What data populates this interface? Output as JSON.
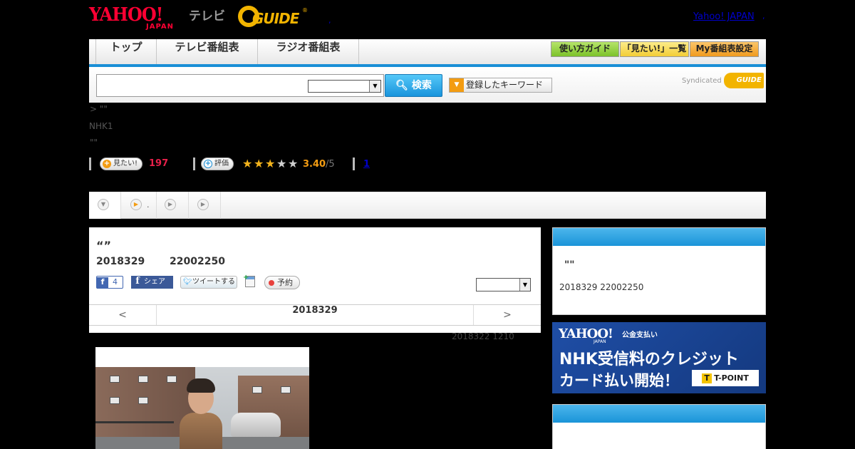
{
  "header": {
    "yahoo_logo": "YAHOO!",
    "yahoo_logo_sub": "JAPAN",
    "tv_label": "テレビ",
    "gguide_logo": "GUIDE",
    "gguide_mark": "®",
    "dot": ",",
    "yahoo_japan_link": "Yahoo! JAPAN",
    "dot2": ","
  },
  "nav": {
    "tabs": [
      "トップ",
      "テレビ番組表",
      "ラジオ番組表"
    ],
    "buttons": [
      "使い方ガイド",
      "「見たい!」一覧",
      "My番組表設定"
    ],
    "button_colors": [
      "#8fd13a",
      "#f8d94c",
      "#f5a623"
    ]
  },
  "search": {
    "input_value": "",
    "select_value": "",
    "button_label": "検索",
    "keyword_button_label": "登録したキーワード",
    "syndicated_label": "Syndicated",
    "syndicated_logo": "GUIDE"
  },
  "program": {
    "breadcrumb": "> \"\"",
    "channel": "NHK1",
    "subtitle": "\"\"",
    "mitai_label": "見たい!",
    "mitai_count": "197",
    "rate_label": "評価",
    "rating_stars": 3.4,
    "rating_value": "3.40",
    "rating_max": "/5",
    "review_count": "1",
    "title": "“”",
    "air_date": "2018329",
    "air_time": "22002250",
    "fb_like_count": "4",
    "fb_share_label": "シェア",
    "tweet_label": "ツイートする",
    "reserve_label": "予約",
    "select_value": "",
    "prev_label": "<",
    "nav_date": "2018329",
    "next_label": ">",
    "update_note": "2018322  1210"
  },
  "tabs_strip": {
    "tab2_text": "."
  },
  "sidebar": {
    "box1_title": "\"\"",
    "box1_date": "2018329  22002250"
  },
  "ad": {
    "yahoo": "YAHOO!",
    "japan": "JAPAN",
    "service": "公金支払い",
    "line1": "NHK受信料のクレジット",
    "line2": "カード払い開始！",
    "tpoint": "T-POINT",
    "tpoint_mark": "T"
  },
  "colors": {
    "accent_blue": "#1a8fd6",
    "yahoo_red": "#ff0033",
    "gguide_yellow": "#f2b400",
    "mitai_pink": "#e8204a",
    "rating_orange": "#f39c12"
  }
}
